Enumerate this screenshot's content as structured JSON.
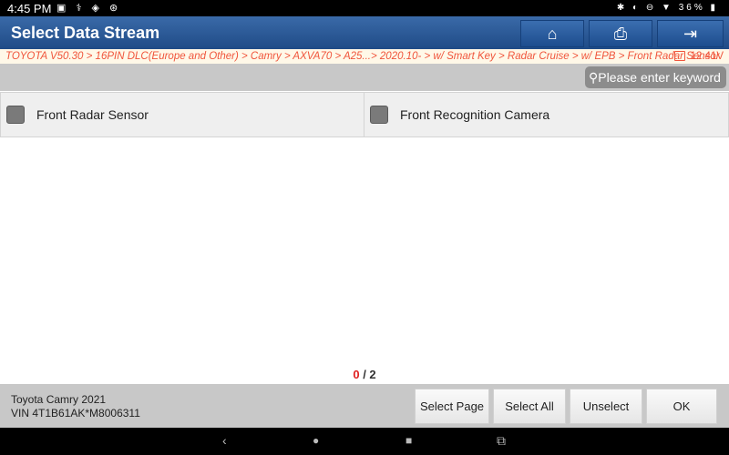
{
  "status_bar": {
    "time": "4:45 PM",
    "left_icons": "▣ ⚕ ◈ ⊛",
    "right_icons": "✱ ◐ ⊖ ▼",
    "battery": "36%"
  },
  "header": {
    "title": "Select Data Stream",
    "buttons": [
      {
        "icon": "home-icon",
        "glyph": "⌂"
      },
      {
        "icon": "print-icon",
        "glyph": "⎙"
      },
      {
        "icon": "exit-icon",
        "glyph": "⇥"
      }
    ]
  },
  "breadcrumb": {
    "path": "TOYOTA V50.30 > 16PIN DLC(Europe and Other) > Camry > AXVA70 > A25...> 2020.10- > w/ Smart Key > Radar Cruise > w/ EPB > Front Radar Sensor",
    "voltage": "12.41V"
  },
  "search": {
    "placeholder": "Please enter keyword",
    "icon": "⚲"
  },
  "items": [
    {
      "label": "Front Radar Sensor",
      "checked": false
    },
    {
      "label": "Front Recognition Camera",
      "checked": false
    }
  ],
  "counter": {
    "selected": "0",
    "separator": " / ",
    "total": "2"
  },
  "vehicle": {
    "name": "Toyota Camry 2021",
    "vin": "VIN 4T1B61AK*M8006311"
  },
  "footer_buttons": {
    "select_page": "Select Page",
    "select_all": "Select All",
    "unselect": "Unselect",
    "ok": "OK"
  },
  "nav_bar": {
    "back": "‹",
    "home": "●",
    "recents": "■",
    "screenshot": "⧉"
  }
}
